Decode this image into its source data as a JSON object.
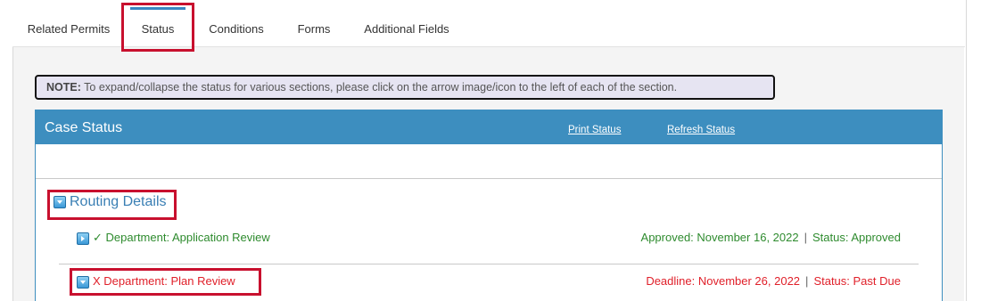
{
  "tabs": [
    {
      "label": "Related Permits",
      "active": false
    },
    {
      "label": "Status",
      "active": true
    },
    {
      "label": "Conditions",
      "active": false
    },
    {
      "label": "Forms",
      "active": false
    },
    {
      "label": "Additional Fields",
      "active": false
    }
  ],
  "note": {
    "prefix": "NOTE:",
    "text": " To expand/collapse the status for various sections, please click on the arrow image/icon to the left of each of the section."
  },
  "case_status": {
    "title": "Case Status",
    "print_link": "Print Status",
    "refresh_link": "Refresh Status"
  },
  "routing": {
    "label": "Routing Details",
    "icon": "collapse-arrow-icon"
  },
  "departments": [
    {
      "mark": "✓",
      "label": "Department: Application Review",
      "date_text": "Approved: November 16, 2022",
      "separator": "|",
      "status_text": "Status: Approved",
      "color": "#2e8b2e",
      "icon": "expand-arrow-icon"
    },
    {
      "mark": "X",
      "label": "Department: Plan Review",
      "date_text": "Deadline: November 26, 2022",
      "separator": "|",
      "status_text": "Status: Past Due",
      "color": "#e0202a",
      "icon": "collapse-arrow-icon"
    }
  ],
  "colors": {
    "accent": "#3d8ebf",
    "highlight": "#c8102e",
    "approved": "#2e8b2e",
    "past_due": "#e0202a",
    "note_bg": "#e6e4f2"
  }
}
